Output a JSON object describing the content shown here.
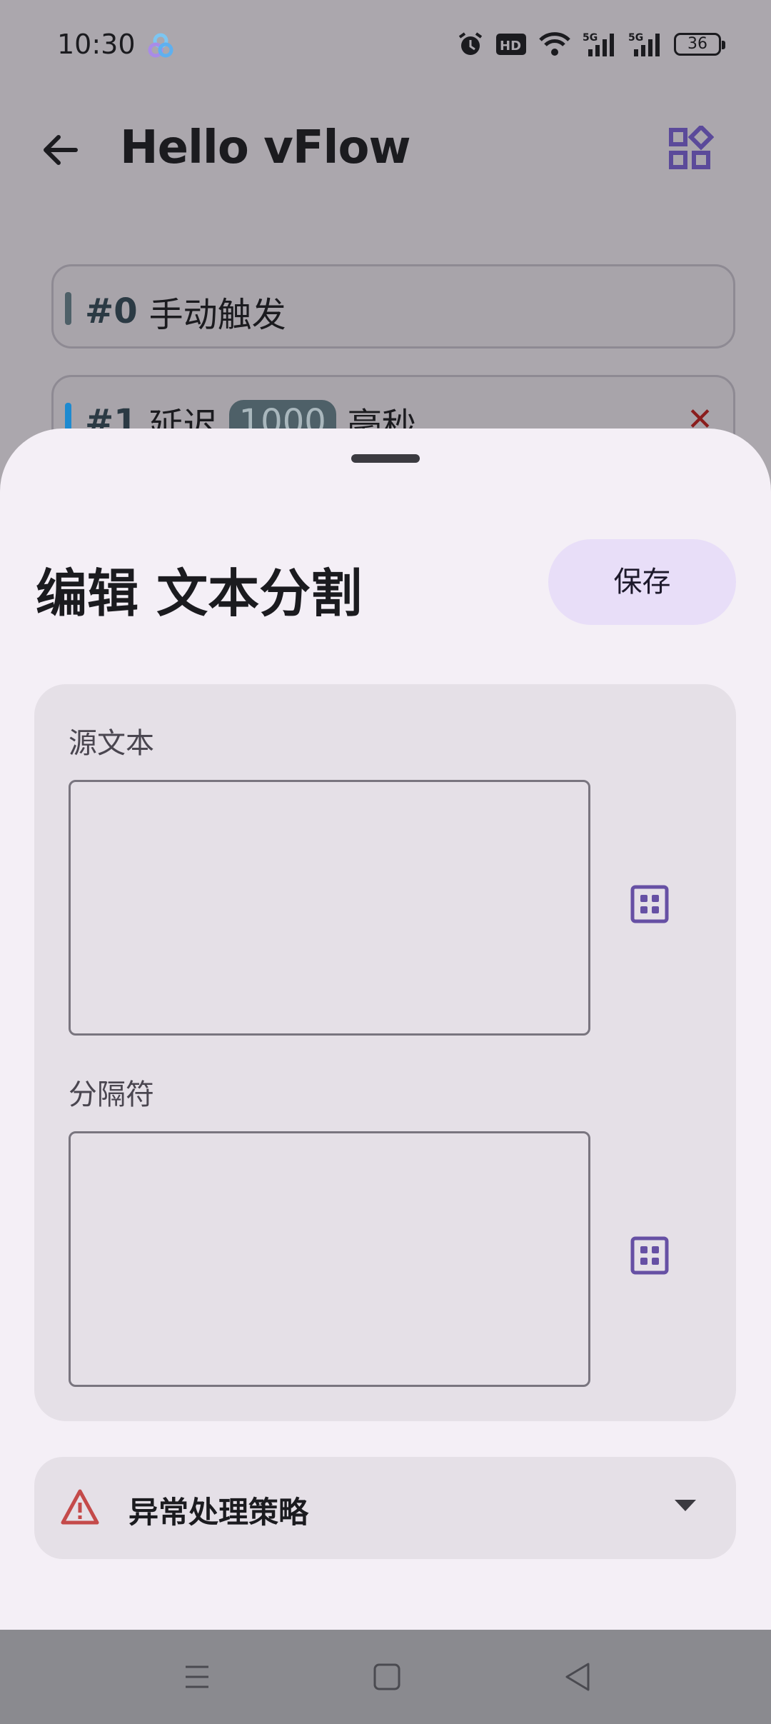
{
  "status_bar": {
    "time": "10:30",
    "battery": "36",
    "icons": [
      "app-icon",
      "alarm-icon",
      "hd-icon",
      "wifi-icon",
      "signal-5g-icon",
      "signal-5g-icon",
      "battery-icon"
    ]
  },
  "app_bar": {
    "title": "Hello vFlow",
    "back_icon": "arrow-back-icon",
    "action_icon": "widgets-icon"
  },
  "background_list": [
    {
      "index": "#0",
      "text": "手动触发",
      "accent": "#4e6068"
    },
    {
      "index": "#1",
      "text_before": "延迟",
      "value": "1000",
      "text_after": "毫秒",
      "accent": "#1e8ad0",
      "delete_icon": "close-icon"
    }
  ],
  "sheet": {
    "title": "编辑 文本分割",
    "save_label": "保存",
    "fields": [
      {
        "label": "源文本",
        "value": "",
        "variable_icon": "variable-picker-icon"
      },
      {
        "label": "分隔符",
        "value": "",
        "variable_icon": "variable-picker-icon"
      }
    ],
    "error_policy": {
      "label": "异常处理策略",
      "icon": "warning-icon",
      "expand_icon": "dropdown-caret-icon"
    }
  },
  "nav_bar": {
    "icons": [
      "menu-icon",
      "home-icon",
      "back-icon"
    ]
  },
  "colors": {
    "accent": "#6650a4",
    "sheet_bg": "#f4eff6",
    "card_bg": "#e5e0e7",
    "save_bg": "#e8def8",
    "warning": "#c44a4a"
  }
}
